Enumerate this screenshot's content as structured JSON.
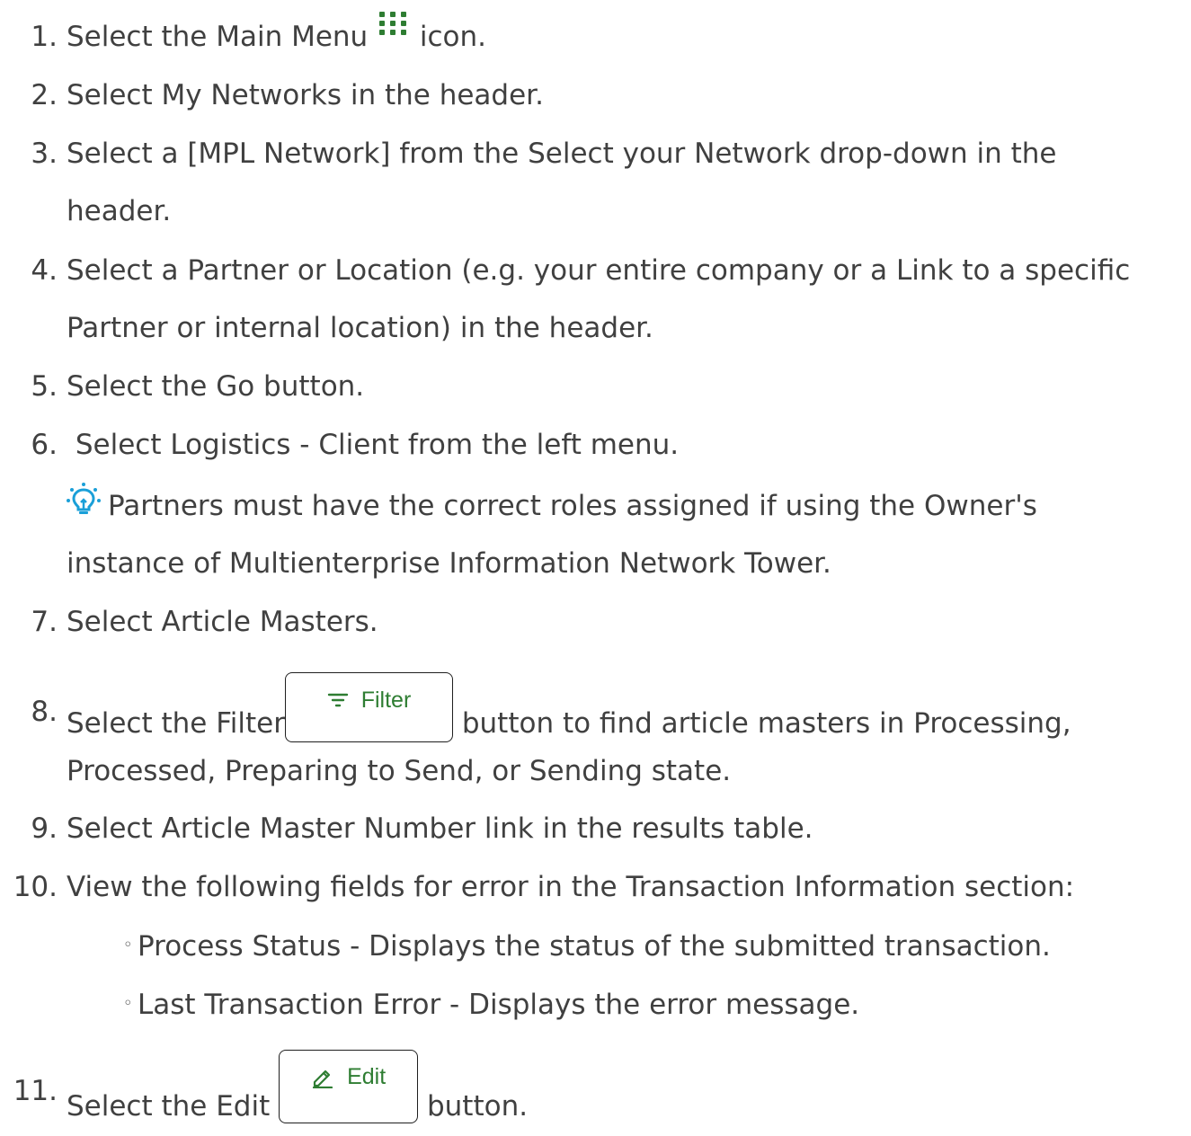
{
  "steps": [
    {
      "num": "1.",
      "pre": "Select the Main Menu ",
      "post": " icon."
    },
    {
      "num": "2.",
      "text": "Select My Networks in the header."
    },
    {
      "num": "3.",
      "line1": "Select a [MPL Network] from the Select your Network drop-down in the",
      "line2": "header."
    },
    {
      "num": "4.",
      "line1": "Select a Partner or Location (e.g. your entire company or a Link to a specific",
      "line2": "Partner or internal location) in the header."
    },
    {
      "num": "5.",
      "text": "Select the Go button."
    },
    {
      "num": "6.",
      "text": " Select Logistics - Client from the left menu."
    },
    {
      "num": "7.",
      "text": "Select Article Masters."
    },
    {
      "num": "8.",
      "pre": "Select the Filter",
      "post": " button to find article masters in Processing,",
      "line2": "Processed, Preparing to Send, or Sending state."
    },
    {
      "num": "9.",
      "text": "Select Article Master Number link in the results table."
    },
    {
      "num": "10.",
      "text": "View the following fields for error in the Transaction Information section:"
    },
    {
      "num": "11.",
      "pre": "Select the Edit ",
      "post": " button."
    }
  ],
  "tip": {
    "line1": "Partners must have the correct roles assigned if using the Owner's",
    "line2": "instance of Multienterprise Information Network Tower.",
    "icon": "lightbulb-icon",
    "icon_color": "#1a9fd8"
  },
  "sub_items": [
    "Process Status - Displays the status of the submitted transaction.",
    "Last Transaction Error - Displays the error message."
  ],
  "buttons": {
    "filter_label": "Filter",
    "edit_label": "Edit",
    "accent_color": "#2e7d32"
  },
  "icons": {
    "main_menu": "grid-dots-icon",
    "main_menu_color": "#2e7d32",
    "filter": "filter-lines-icon",
    "edit": "pencil-icon"
  }
}
